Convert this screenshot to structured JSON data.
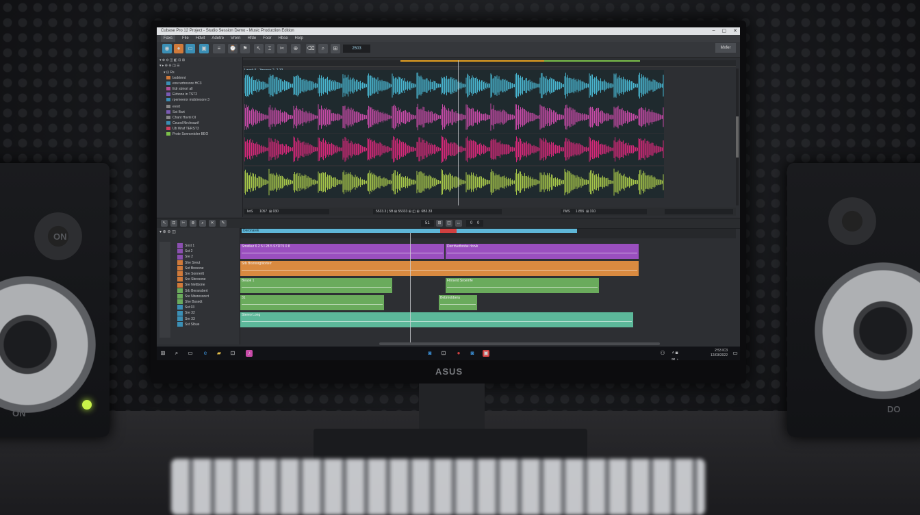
{
  "window": {
    "title": "Cubase Pro 12 Project - Studio Session Demo - Music Production Edition",
    "controls": [
      "–",
      "▢",
      "✕"
    ]
  },
  "menu": [
    "Faxs",
    "File",
    "Hdvit",
    "Adetre",
    "Vrern",
    "Hfde",
    "Foor",
    "Hbse",
    "Help"
  ],
  "toolbar": {
    "counter": "2503",
    "mixer_label": "Mxfer"
  },
  "upper_tracks": [
    {
      "label": "bxdrtmnt",
      "color": "#d07a3a"
    },
    {
      "label": "exw wrtresore HC3",
      "color": "#3b8fb5"
    },
    {
      "label": "Edr sbirort all",
      "color": "#b14f9a"
    },
    {
      "label": "Eirbone in TST2",
      "color": "#7b5bb5"
    },
    {
      "label": "rpemeeror mobtresore 3",
      "color": "#3b8fb5"
    },
    {
      "label": "evort",
      "color": "#888888"
    },
    {
      "label": "Sst Bart",
      "color": "#7b5bb5"
    },
    {
      "label": "Chant Hovrii OI",
      "color": "#888888"
    },
    {
      "label": "Ceuod Mrchraurif",
      "color": "#3b8fb5"
    },
    {
      "label": "Ub Wraf TERST3",
      "color": "#d04060"
    },
    {
      "label": "Prote Sonnontoler BEO",
      "color": "#7cc04a"
    }
  ],
  "clip_header": "Lwerk 5 - 3mesos 2 -2 33",
  "waveform_colors": [
    "#49b7d1",
    "#c84aa8",
    "#d8287a",
    "#a8c84a"
  ],
  "status": {
    "left_a": "IwS",
    "left_b": "1057",
    "left_c": "030",
    "mid_a": "5533.3",
    "mid_b": "5B",
    "mid_c": "55333",
    "mid_d": "6B3.33",
    "right_a": "IWS",
    "right_b": "1.855",
    "right_c": "310"
  },
  "midbar": {
    "ctl_a": "51",
    "ctl_b": "0",
    "ctl_c": "0"
  },
  "lower_tracks": [
    {
      "label": "Sost 1",
      "color": "#8b4fb0"
    },
    {
      "label": "Sst 2",
      "color": "#8b4fb0"
    },
    {
      "label": "Sre 2",
      "color": "#8b4fb0"
    },
    {
      "label": "She Sreut",
      "color": "#d07a3a"
    },
    {
      "label": "Sot Bresone",
      "color": "#d07a3a"
    },
    {
      "label": "Sre Sonnertt",
      "color": "#d07a3a"
    },
    {
      "label": "Sre Sbresone",
      "color": "#d07a3a"
    },
    {
      "label": "Sre Nettbone",
      "color": "#d07a3a"
    },
    {
      "label": "Srb Beransbert",
      "color": "#6aab5c"
    },
    {
      "label": "Sre Ntwresorert",
      "color": "#6aab5c"
    },
    {
      "label": "She Bssedt",
      "color": "#6aab5c"
    },
    {
      "label": "Sst 03",
      "color": "#3b8fb5"
    },
    {
      "label": "Sre 32",
      "color": "#3b8fb5"
    },
    {
      "label": "Sre 33",
      "color": "#3b8fb5"
    },
    {
      "label": "Sst Slbue",
      "color": "#3b8fb5"
    }
  ],
  "arrange": {
    "cycle_label": "Deronarek",
    "regions": [
      {
        "label": "Smstkur 6 2 5 I 28 5 SYDT5 0 8",
        "color": "#9a4fbf"
      },
      {
        "label": "Derrdvethrsbe rlorvk",
        "color": "#9a4fbf"
      },
      {
        "label": "Srb Brsrnnrgtiiorterr",
        "color": "#d98a40"
      },
      {
        "label": "Beaok 1",
        "color": "#6aab5c"
      },
      {
        "label": "Ftrrserd Sroemfe",
        "color": "#6aab5c"
      },
      {
        "label": "31",
        "color": "#6aab5c"
      },
      {
        "label": "Bebnrobbera",
        "color": "#6aab5c"
      },
      {
        "label": "Stereo Long",
        "color": "#5cb89a"
      }
    ]
  },
  "taskbar": {
    "time": "2:53 IC3",
    "date": "12/03/2022"
  },
  "hardware": {
    "brand": "ASUS",
    "left_speaker_top": "ON",
    "left_speaker_bottom": "ON",
    "right_speaker": "DO"
  }
}
